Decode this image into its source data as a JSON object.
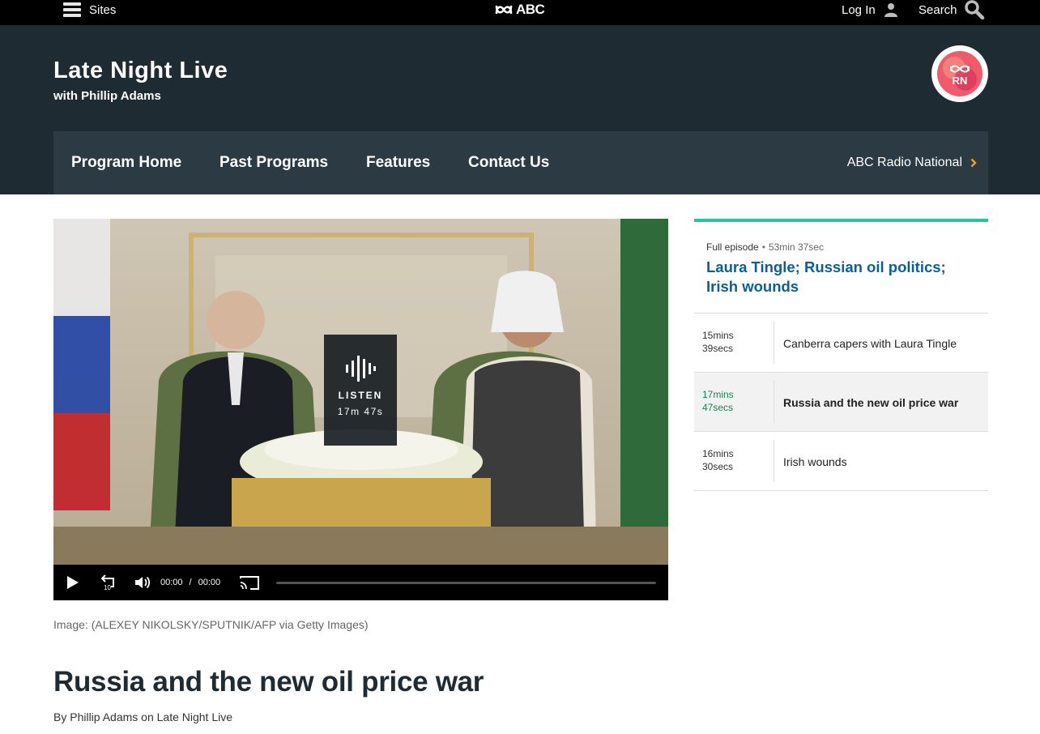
{
  "topbar": {
    "sites_label": "Sites",
    "logo_text": "ABC",
    "login_label": "Log In",
    "search_label": "Search"
  },
  "program": {
    "title": "Late Night Live",
    "subtitle": "with Phillip Adams"
  },
  "nav": {
    "items": [
      "Program Home",
      "Past Programs",
      "Features",
      "Contact Us"
    ],
    "network": "ABC Radio National"
  },
  "player": {
    "listen_label": "LISTEN",
    "listen_duration": "17m 47s",
    "current_time": "00:00",
    "separator": "/",
    "total_time": "00:00"
  },
  "caption": "Image: (ALEXEY NIKOLSKY/SPUTNIK/AFP via Getty Images)",
  "headline": "Russia and the new oil price war",
  "byline": "By Phillip Adams on Late Night Live",
  "sidebar": {
    "kind": "Full episode",
    "bullet": "•",
    "length": "53min 37sec",
    "episode_title": "Laura Tingle; Russian oil politics; Irish wounds",
    "segments": [
      {
        "mins": "15mins",
        "secs": "39secs",
        "title": "Canberra capers with Laura Tingle"
      },
      {
        "mins": "17mins",
        "secs": "47secs",
        "title": "Russia and the new oil price war"
      },
      {
        "mins": "16mins",
        "secs": "30secs",
        "title": "Irish wounds"
      }
    ]
  },
  "colors": {
    "header_bg": "#1f2b33",
    "nav_bg": "#2c3a44",
    "accent_teal": "#22c4a3",
    "link_blue": "#0b5f97",
    "chevron_orange": "#ff9a1a"
  }
}
